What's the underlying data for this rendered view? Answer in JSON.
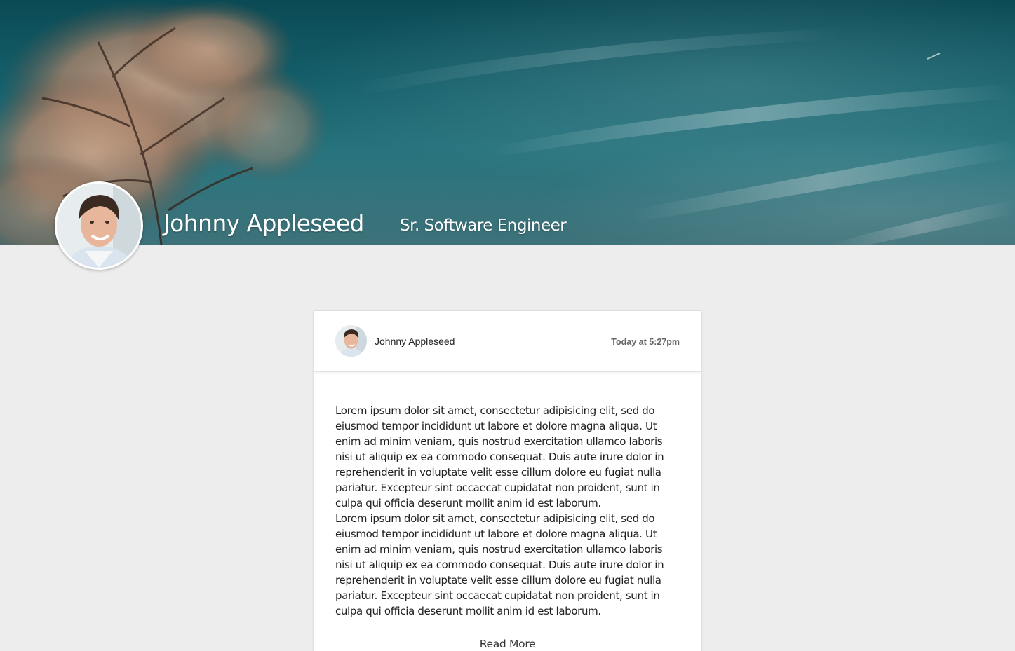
{
  "profile": {
    "name": "Johnny Appleseed",
    "title": "Sr. Software Engineer"
  },
  "post": {
    "author": "Johnny Appleseed",
    "timestamp": "Today at 5:27pm",
    "paragraphs": [
      "Lorem ipsum dolor sit amet, consectetur adipisicing elit, sed do eiusmod tempor incididunt ut labore et dolore magna aliqua. Ut enim ad minim veniam, quis nostrud exercitation ullamco laboris nisi ut aliquip ex ea commodo consequat. Duis aute irure dolor in reprehenderit in voluptate velit esse cillum dolore eu fugiat nulla pariatur. Excepteur sint occaecat cupidatat non proident, sunt in culpa qui officia deserunt mollit anim id est laborum.",
      "Lorem ipsum dolor sit amet, consectetur adipisicing elit, sed do eiusmod tempor incididunt ut labore et dolore magna aliqua. Ut enim ad minim veniam, quis nostrud exercitation ullamco laboris nisi ut aliquip ex ea commodo consequat. Duis aute irure dolor in reprehenderit in voluptate velit esse cillum dolore eu fugiat nulla pariatur. Excepteur sint occaecat cupidatat non proident, sunt in culpa qui officia deserunt mollit anim id est laborum."
    ],
    "read_more_label": "Read More"
  },
  "colors": {
    "page_background": "#ededed",
    "sky": "#15606b",
    "foliage": "#c9a48a"
  }
}
